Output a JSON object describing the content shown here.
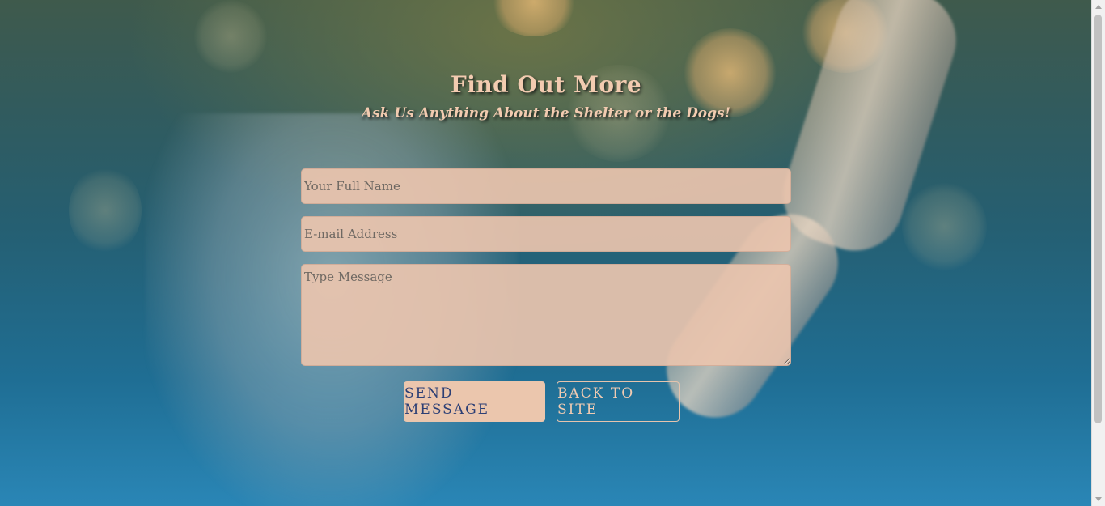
{
  "header": {
    "title": "Find Out More",
    "subtitle": "Ask Us Anything About the Shelter or the Dogs!"
  },
  "form": {
    "name_placeholder": "Your Full Name",
    "email_placeholder": "E-mail Address",
    "message_placeholder": "Type Message"
  },
  "buttons": {
    "send_label": "SEND MESSAGE",
    "back_label": "BACK TO SITE"
  },
  "colors": {
    "accent": "#ebc6ad",
    "send_text": "#2c3f75",
    "background_bottom": "#2a86b6"
  }
}
